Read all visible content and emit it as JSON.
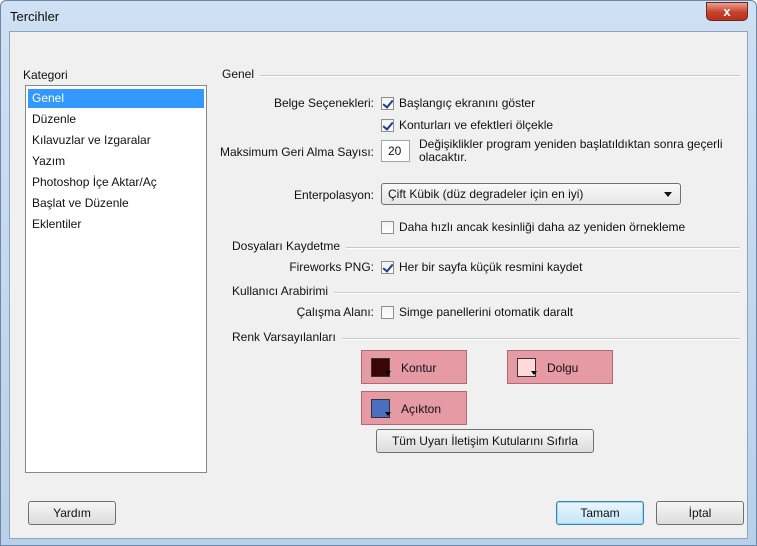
{
  "window": {
    "title": "Tercihler",
    "close_label": "x"
  },
  "category": {
    "label": "Kategori",
    "items": [
      "Genel",
      "Düzenle",
      "Kılavuzlar ve Izgaralar",
      "Yazım",
      "Photoshop İçe Aktar/Aç",
      "Başlat ve Düzenle",
      "Eklentiler"
    ],
    "selected": "Genel"
  },
  "general": {
    "section_title": "Genel",
    "doc_options_label": "Belge Seçenekleri:",
    "show_start_screen": {
      "label": "Başlangıç ekranını göster",
      "checked": true
    },
    "scale_strokes": {
      "label": "Konturları ve efektleri ölçekle",
      "checked": true
    },
    "max_undo_label": "Maksimum Geri Alma Sayısı:",
    "max_undo_value": "20",
    "restart_note": "Değişiklikler program yeniden başlatıldıktan sonra geçerli olacaktır.",
    "interpolation_label": "Enterpolasyon:",
    "interpolation_value": "Çift Kübik (düz degradeler için en iyi)",
    "faster_resample": {
      "label": "Daha hızlı ancak kesinliği daha az yeniden örnekleme",
      "checked": false
    }
  },
  "save_files": {
    "section_title": "Dosyaları Kaydetme",
    "png_label": "Fireworks PNG:",
    "save_thumbnails": {
      "label": "Her bir sayfa küçük resmini kaydet",
      "checked": true
    }
  },
  "ui": {
    "section_title": "Kullanıcı Arabirimi",
    "workspace_label": "Çalışma Alanı:",
    "auto_collapse": {
      "label": "Simge panellerini otomatik daralt",
      "checked": false
    }
  },
  "colors": {
    "section_title": "Renk Varsayılanları",
    "stroke": {
      "label": "Kontur",
      "color": "#3a0505"
    },
    "fill": {
      "label": "Dolgu",
      "color": "#ffd9d9"
    },
    "highlight": {
      "label": "Açıkton",
      "color": "#4a6fc0"
    },
    "accent": "#e59aa4"
  },
  "reset_alerts_label": "Tüm Uyarı İletişim Kutularını Sıfırla",
  "footer": {
    "help": "Yardım",
    "ok": "Tamam",
    "cancel": "İptal"
  }
}
